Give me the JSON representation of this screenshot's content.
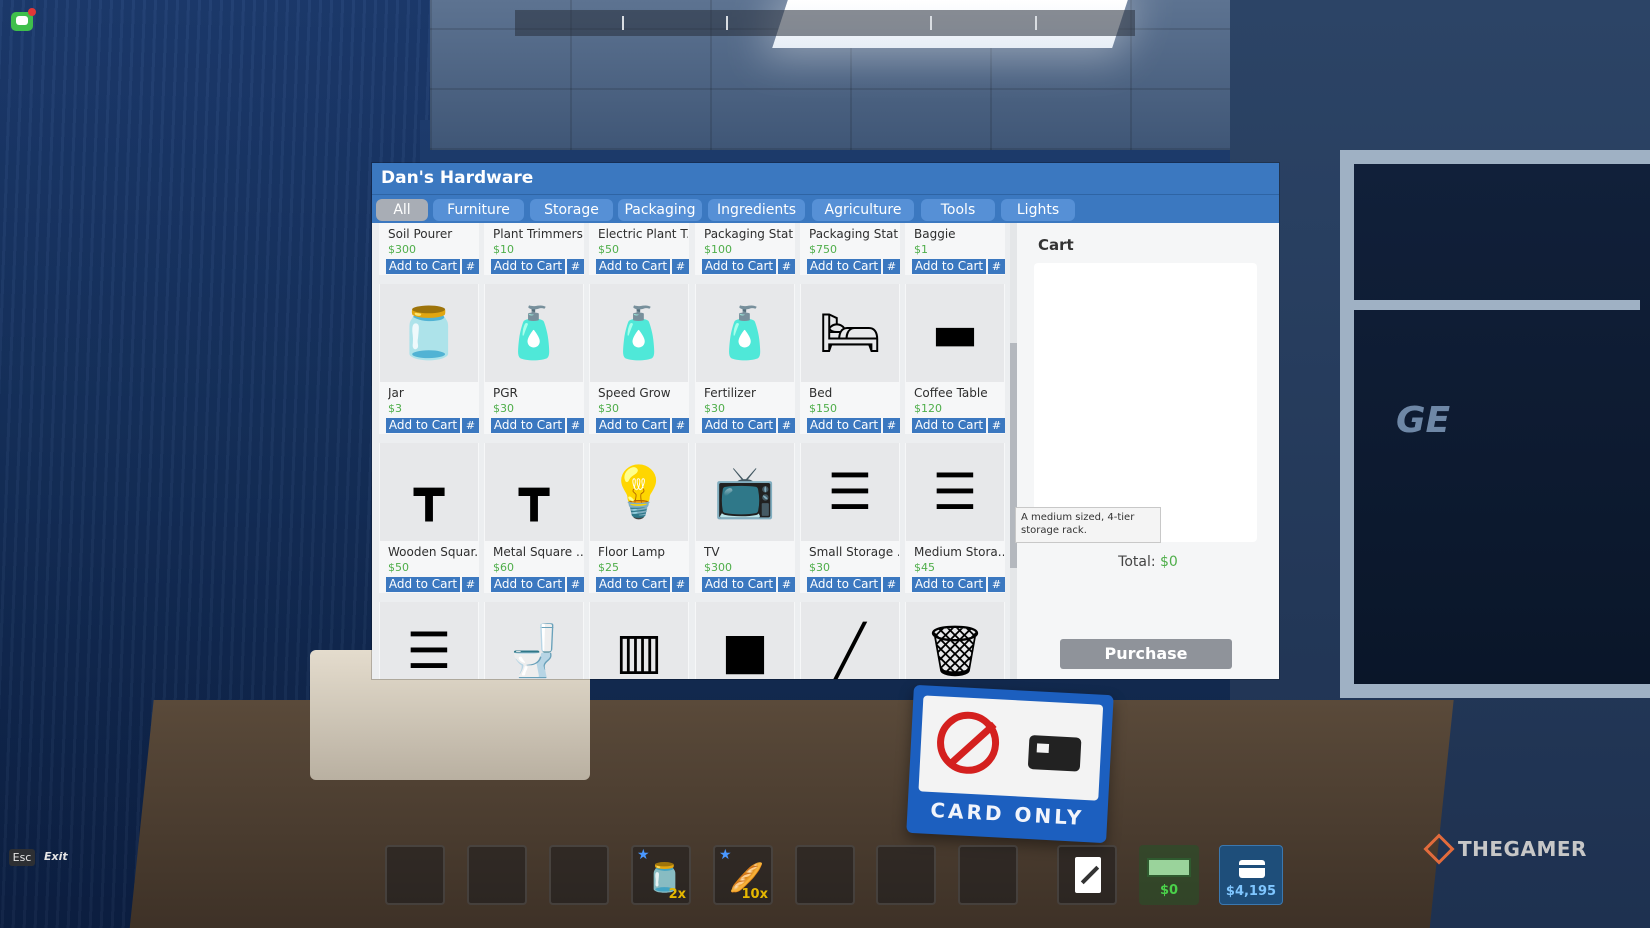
{
  "shop": {
    "title": "Dan's Hardware",
    "tabs": [
      {
        "label": "All",
        "active": true
      },
      {
        "label": "Furniture",
        "active": false
      },
      {
        "label": "Storage",
        "active": false
      },
      {
        "label": "Packaging",
        "active": false
      },
      {
        "label": "Ingredients",
        "active": false
      },
      {
        "label": "Agriculture",
        "active": false
      },
      {
        "label": "Tools",
        "active": false
      },
      {
        "label": "Lights",
        "active": false
      }
    ],
    "add_label": "Add to Cart",
    "hash_label": "#",
    "items": [
      {
        "name": "Soil Pourer",
        "price": "$300",
        "icon": "soil-pourer-icon",
        "glyph": ""
      },
      {
        "name": "Plant Trimmers",
        "price": "$10",
        "icon": "plant-trimmers-icon",
        "glyph": ""
      },
      {
        "name": "Electric Plant T...",
        "price": "$50",
        "icon": "electric-plant-trimmer-icon",
        "glyph": ""
      },
      {
        "name": "Packaging Stat...",
        "price": "$100",
        "icon": "packaging-station-icon",
        "glyph": ""
      },
      {
        "name": "Packaging Stat...",
        "price": "$750",
        "icon": "packaging-station-mk2-icon",
        "glyph": ""
      },
      {
        "name": "Baggie",
        "price": "$1",
        "icon": "baggie-icon",
        "glyph": ""
      },
      {
        "name": "Jar",
        "price": "$3",
        "icon": "jar-icon",
        "glyph": "🫙"
      },
      {
        "name": "PGR",
        "price": "$30",
        "icon": "pgr-bottle-icon",
        "glyph": "🧴"
      },
      {
        "name": "Speed Grow",
        "price": "$30",
        "icon": "speed-grow-bottle-icon",
        "glyph": "🧴"
      },
      {
        "name": "Fertilizer",
        "price": "$30",
        "icon": "fertilizer-bottle-icon",
        "glyph": "🧴"
      },
      {
        "name": "Bed",
        "price": "$150",
        "icon": "bed-icon",
        "glyph": "🛏"
      },
      {
        "name": "Coffee Table",
        "price": "$120",
        "icon": "coffee-table-icon",
        "glyph": "▬"
      },
      {
        "name": "Wooden Squar...",
        "price": "$50",
        "icon": "wooden-square-table-icon",
        "glyph": "┳"
      },
      {
        "name": "Metal Square ...",
        "price": "$60",
        "icon": "metal-square-table-icon",
        "glyph": "┳"
      },
      {
        "name": "Floor Lamp",
        "price": "$25",
        "icon": "floor-lamp-icon",
        "glyph": "💡"
      },
      {
        "name": "TV",
        "price": "$300",
        "icon": "tv-icon",
        "glyph": "📺"
      },
      {
        "name": "Small Storage ...",
        "price": "$30",
        "icon": "small-storage-rack-icon",
        "glyph": "☰"
      },
      {
        "name": "Medium Stora...",
        "price": "$45",
        "icon": "medium-storage-rack-icon",
        "glyph": "☰"
      },
      {
        "name": "",
        "price": "",
        "icon": "large-storage-rack-icon",
        "glyph": "☰"
      },
      {
        "name": "",
        "price": "",
        "icon": "toilet-icon",
        "glyph": "🚽"
      },
      {
        "name": "",
        "price": "",
        "icon": "wooden-shelf-icon",
        "glyph": "▥"
      },
      {
        "name": "",
        "price": "",
        "icon": "trash-bag-icon",
        "glyph": "■"
      },
      {
        "name": "",
        "price": "",
        "icon": "trash-grabber-icon",
        "glyph": "╱"
      },
      {
        "name": "",
        "price": "",
        "icon": "trash-can-icon",
        "glyph": "🗑"
      }
    ],
    "cart": {
      "title": "Cart",
      "total_label": "Total:",
      "total_value": "$0",
      "purchase_label": "Purchase"
    },
    "tooltip": "A medium sized, 4-tier storage rack."
  },
  "hud": {
    "esc_key": "Esc",
    "esc_label": "Exit",
    "slots": [
      {
        "count": "",
        "star": false,
        "glyph": ""
      },
      {
        "count": "",
        "star": false,
        "glyph": ""
      },
      {
        "count": "",
        "star": false,
        "glyph": ""
      },
      {
        "count": "2x",
        "star": true,
        "glyph": "🫙",
        "icon": "jar-icon"
      },
      {
        "count": "10x",
        "star": true,
        "glyph": "🥖",
        "icon": "baggie-icon"
      },
      {
        "count": "",
        "star": false,
        "glyph": ""
      },
      {
        "count": "",
        "star": false,
        "glyph": ""
      },
      {
        "count": "",
        "star": false,
        "glyph": ""
      }
    ],
    "cash": "$0",
    "bank": "$4,195"
  },
  "scene": {
    "sign_text": "CARD ONLY",
    "wall_text": "GE"
  },
  "watermark": "THEGAMER"
}
